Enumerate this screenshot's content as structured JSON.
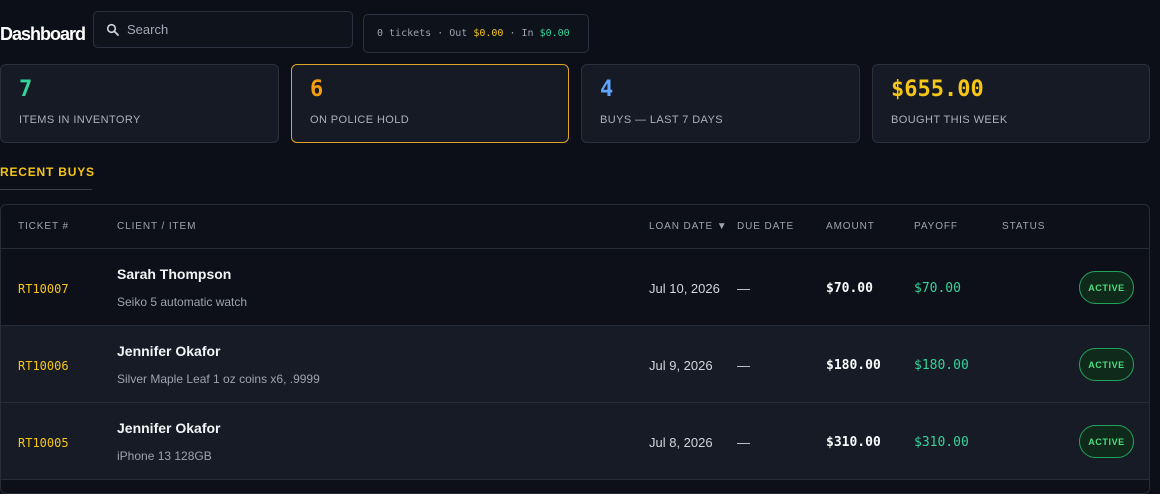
{
  "header": {
    "title": "Dashboard",
    "search_placeholder": "Search",
    "summary": {
      "tickets": "0 tickets",
      "sep1": " · Out ",
      "out_value": "$0.00",
      "sep2": " · In ",
      "in_value": "$0.00"
    }
  },
  "stats": [
    {
      "value": "7",
      "label": "ITEMS IN INVENTORY",
      "color": "#34d399"
    },
    {
      "value": "6",
      "label": "ON POLICE HOLD",
      "color": "#f59e0b"
    },
    {
      "value": "4",
      "label": "BUYS — LAST 7 DAYS",
      "color": "#60a5fa"
    },
    {
      "value": "$655.00",
      "label": "BOUGHT THIS WEEK",
      "color": "#f5c518"
    }
  ],
  "section": {
    "title": "RECENT BUYS"
  },
  "table": {
    "columns": {
      "ticket": "TICKET #",
      "client": "CLIENT / ITEM",
      "loan_date": "LOAN DATE ▼",
      "due_date": "DUE DATE",
      "amount": "AMOUNT",
      "payoff": "PAYOFF",
      "status": "STATUS"
    },
    "rows": [
      {
        "ticket": "RT10007",
        "client": "Sarah Thompson",
        "item": "Seiko 5 automatic watch",
        "loan_date": "Jul 10, 2026",
        "due_date": "—",
        "amount": "$70.00",
        "payoff": "$70.00",
        "status": "ACTIVE"
      },
      {
        "ticket": "RT10006",
        "client": "Jennifer Okafor",
        "item": "Silver Maple Leaf 1 oz coins x6, .9999",
        "loan_date": "Jul 9, 2026",
        "due_date": "—",
        "amount": "$180.00",
        "payoff": "$180.00",
        "status": "ACTIVE"
      },
      {
        "ticket": "RT10005",
        "client": "Jennifer Okafor",
        "item": "iPhone 13 128GB",
        "loan_date": "Jul 8, 2026",
        "due_date": "—",
        "amount": "$310.00",
        "payoff": "$310.00",
        "status": "ACTIVE"
      }
    ]
  }
}
